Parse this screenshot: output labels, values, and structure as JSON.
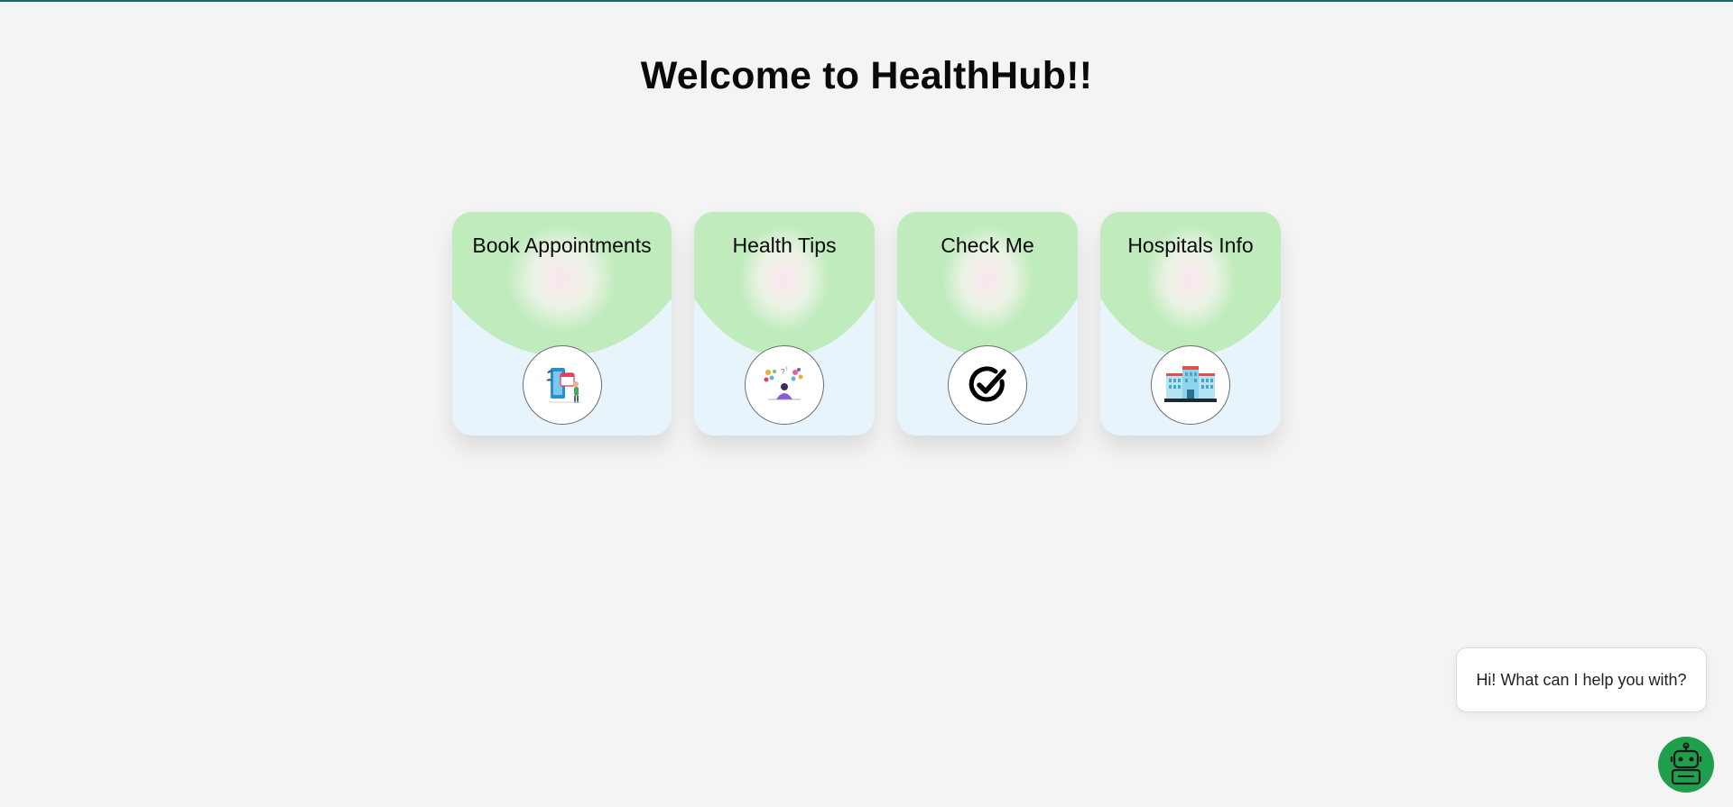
{
  "page": {
    "title": "Welcome to HealthHub!!",
    "accent_color": "#0f6b63",
    "background_color": "#f4f4f4"
  },
  "cards": [
    {
      "label": "Book Appointments",
      "icon": "calendar-booking-icon"
    },
    {
      "label": "Health Tips",
      "icon": "health-tips-icon"
    },
    {
      "label": "Check Me",
      "icon": "checkmark-circle-icon"
    },
    {
      "label": "Hospitals Info",
      "icon": "hospital-building-icon"
    }
  ],
  "card_colors": {
    "top_green": "#bfebbd",
    "bottom_blue": "#e8f4fb",
    "glow_pink": "#fbe6ef"
  },
  "chat": {
    "prompt": "Hi! What can I help you with?",
    "bot_icon": "robot-icon",
    "bot_color": "#1f9e4c"
  }
}
